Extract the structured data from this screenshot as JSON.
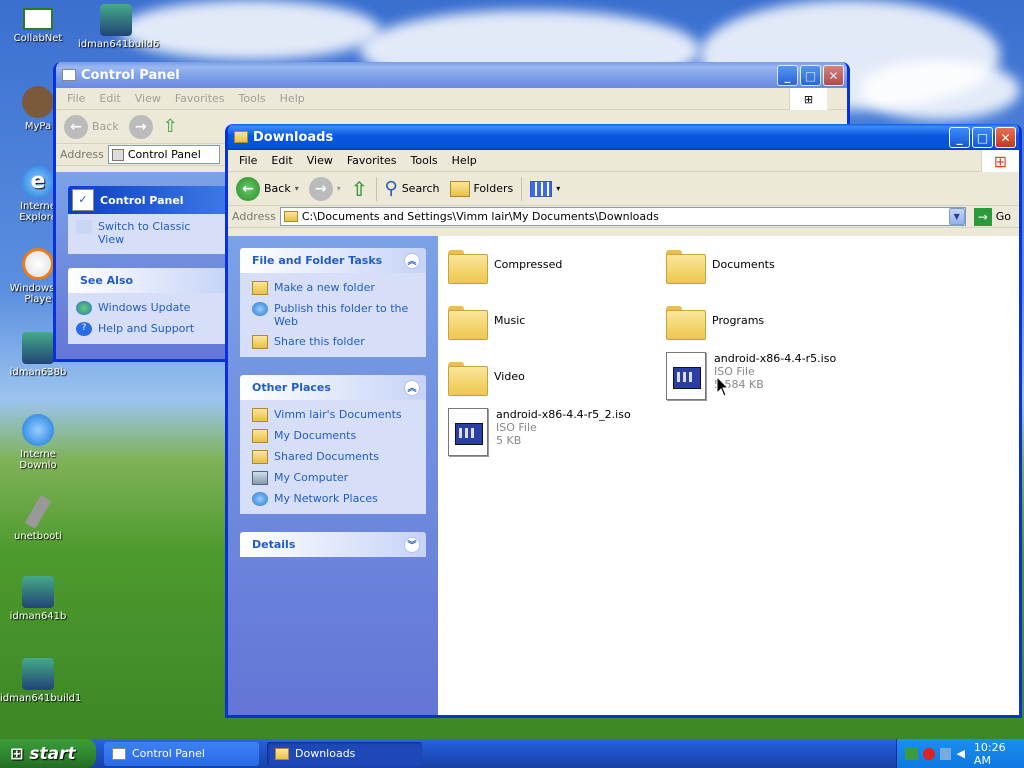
{
  "desktop": {
    "icons": [
      "CollabNet",
      "idman641build6",
      "MyPa",
      "Interne Explore",
      "Windows M Playe",
      "idman638b",
      "Interne Downlo",
      "unetbooti",
      "idman641b",
      "idman641build1"
    ]
  },
  "control_panel": {
    "title": "Control Panel",
    "menu": [
      "File",
      "Edit",
      "View",
      "Favorites",
      "Tools",
      "Help"
    ],
    "back": "Back",
    "address_label": "Address",
    "address": "Control Panel",
    "panel_title": "Control Panel",
    "switch_link": "Switch to Classic View",
    "see_also": "See Also",
    "see_also_links": [
      "Windows Update",
      "Help and Support"
    ]
  },
  "downloads": {
    "title": "Downloads",
    "menu": [
      "File",
      "Edit",
      "View",
      "Favorites",
      "Tools",
      "Help"
    ],
    "toolbar": {
      "back": "Back",
      "search": "Search",
      "folders": "Folders"
    },
    "address_label": "Address",
    "address": "C:\\Documents and Settings\\Vimm lair\\My Documents\\Downloads",
    "go": "Go",
    "file_tasks": {
      "title": "File and Folder Tasks",
      "links": [
        "Make a new folder",
        "Publish this folder to the Web",
        "Share this folder"
      ]
    },
    "other_places": {
      "title": "Other Places",
      "links": [
        "Vimm lair's Documents",
        "My Documents",
        "Shared Documents",
        "My Computer",
        "My Network Places"
      ]
    },
    "details": {
      "title": "Details"
    },
    "items": [
      {
        "name": "Compressed",
        "type": "folder"
      },
      {
        "name": "Documents",
        "type": "folder"
      },
      {
        "name": "Music",
        "type": "folder"
      },
      {
        "name": "Programs",
        "type": "folder"
      },
      {
        "name": "Video",
        "type": "folder"
      },
      {
        "name": "android-x86-4.4-r5.iso",
        "type": "ISO File",
        "size": "5,584 KB"
      },
      {
        "name": "android-x86-4.4-r5_2.iso",
        "type": "ISO File",
        "size": "5 KB"
      }
    ]
  },
  "taskbar": {
    "start": "start",
    "tasks": [
      "Control Panel",
      "Downloads"
    ],
    "clock": "10:26 AM"
  },
  "colors": {
    "xp_blue": "#0a58e0",
    "taskpane_link": "#215dc6",
    "start_green": "#2f8a2f"
  }
}
